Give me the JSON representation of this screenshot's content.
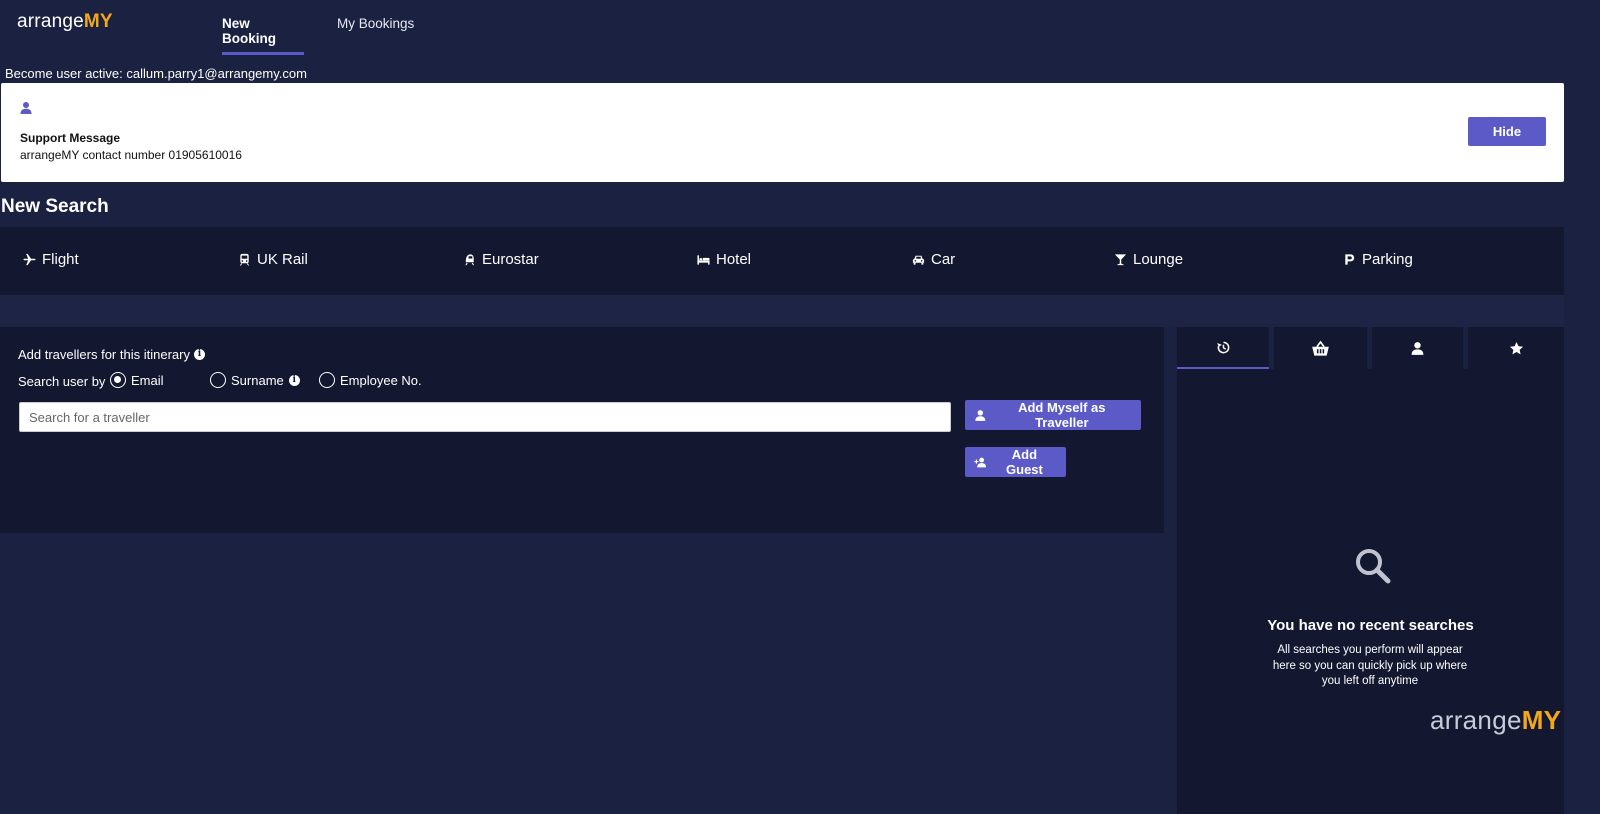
{
  "header": {
    "logo_main": "arrange",
    "logo_accent": "MY",
    "nav": [
      {
        "label": "New Booking",
        "active": true
      },
      {
        "label": "My Bookings",
        "active": false
      }
    ]
  },
  "active_user_text": "Become user active: callum.parry1@arrangemy.com",
  "support": {
    "title": "Support Message",
    "body": "arrangeMY contact number 01905610016",
    "hide_label": "Hide"
  },
  "search": {
    "title": "New Search",
    "products": [
      {
        "label": "Flight",
        "icon": "plane-icon"
      },
      {
        "label": "UK Rail",
        "icon": "train-icon"
      },
      {
        "label": "Eurostar",
        "icon": "eurostar-icon"
      },
      {
        "label": "Hotel",
        "icon": "bed-icon"
      },
      {
        "label": "Car",
        "icon": "car-icon"
      },
      {
        "label": "Lounge",
        "icon": "cocktail-icon"
      },
      {
        "label": "Parking",
        "icon": "parking-icon"
      }
    ]
  },
  "travellers": {
    "label": "Add travellers for this itinerary",
    "search_by_label": "Search user by",
    "options": [
      {
        "label": "Email",
        "selected": true
      },
      {
        "label": "Surname",
        "selected": false
      },
      {
        "label": "Employee No.",
        "selected": false
      }
    ],
    "input_placeholder": "Search for a traveller",
    "add_myself_label": "Add Myself as Traveller",
    "add_guest_label": "Add Guest"
  },
  "sidebar": {
    "tabs": [
      {
        "icon": "history-icon",
        "active": true
      },
      {
        "icon": "basket-icon",
        "active": false
      },
      {
        "icon": "user-icon",
        "active": false
      },
      {
        "icon": "star-icon",
        "active": false
      }
    ],
    "empty_title": "You have no recent searches",
    "empty_body": "All searches you perform will appear here so you can quickly pick up where you left off anytime"
  },
  "watermark": {
    "main": "arrange",
    "accent": "MY"
  },
  "colors": {
    "accent": "#5b5ac7",
    "brand_orange": "#f2a81d",
    "background": "#1b2140",
    "panel": "#131730"
  }
}
